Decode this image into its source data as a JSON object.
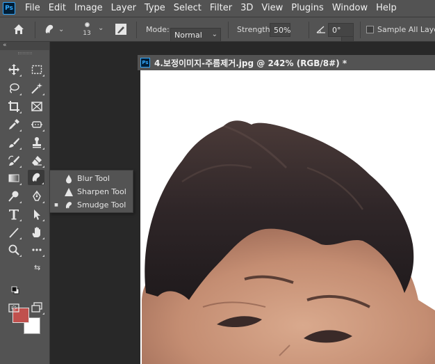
{
  "menubar": {
    "logo": "Ps",
    "items": [
      "File",
      "Edit",
      "Image",
      "Layer",
      "Type",
      "Select",
      "Filter",
      "3D",
      "View",
      "Plugins",
      "Window",
      "Help"
    ]
  },
  "options": {
    "brush_size": "13",
    "mode_label": "Mode:",
    "mode_value": "Normal",
    "strength_label": "Strength:",
    "strength_value": "50%",
    "angle_value": "0°",
    "sample_all_layers": "Sample All Layers"
  },
  "toolbar": {
    "collapse": "«",
    "foreground_color": "#c0504d",
    "background_color": "#ffffff",
    "tools": [
      "move-tool",
      "rectangular-marquee-tool",
      "lasso-tool",
      "magic-wand-tool",
      "crop-tool",
      "frame-tool",
      "eyedropper-tool",
      "spot-healing-tool",
      "brush-tool",
      "clone-stamp-tool",
      "history-brush-tool",
      "eraser-tool",
      "gradient-tool",
      "smudge-tool",
      "dodge-tool",
      "pen-tool",
      "type-tool",
      "path-selection-tool",
      "line-tool",
      "hand-tool",
      "zoom-tool",
      "edit-toolbar"
    ]
  },
  "flyout": {
    "items": [
      {
        "label": "Blur Tool",
        "icon": "drop-icon",
        "active": false
      },
      {
        "label": "Sharpen Tool",
        "icon": "triangle-icon",
        "active": false
      },
      {
        "label": "Smudge Tool",
        "icon": "finger-icon",
        "active": true
      }
    ],
    "active_marker": "■"
  },
  "document": {
    "tab_icon": "Ps",
    "title": "4.보정이미지-주름제거.jpg @ 242% (RGB/8#) *"
  }
}
